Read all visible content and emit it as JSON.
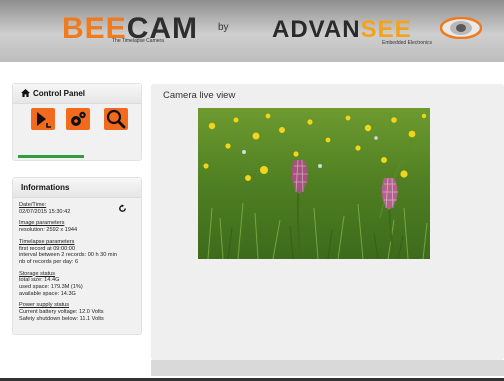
{
  "header": {
    "logo_left_part1": "BEE",
    "logo_left_part2": "CAM",
    "logo_tagline": "The Timelapse Camera",
    "by": "by",
    "logo_right_part1": "ADVAN",
    "logo_right_part2": "SEE",
    "logo_right_tagline": "Embedded Electronics",
    "eye_logo_icon": "eye-logo-icon",
    "logo_orange": "#f07a1e"
  },
  "control_panel": {
    "title": "Control Panel",
    "home_icon": "home-icon",
    "buttons": [
      {
        "icon": "play-record-icon"
      },
      {
        "icon": "settings-gears-icon"
      },
      {
        "icon": "zoom-search-icon"
      }
    ],
    "accent": "#f26b1d",
    "progress_color": "#2f9e3b"
  },
  "informations": {
    "title": "Informations",
    "datetime_title": "Date/Time:",
    "datetime_value": "02/07/2015 15:30:42",
    "refresh_icon": "refresh-icon",
    "image_title": "Image parameters",
    "image_resolution": "resolution: 2592 x 1944",
    "timelapse_title": "Timelapse parameters",
    "timelapse_first": "first record at 09:00:00",
    "timelapse_interval": "interval between 2 records: 00 h 30 min",
    "timelapse_records": "nb of records per day: 6",
    "storage_title": "Storage status",
    "storage_total": "total size: 14.4G",
    "storage_used": "used space: 179.3M (1%)",
    "storage_available": "available space: 14.3G",
    "power_title": "Power supply status",
    "power_battery": "Current battery voltage: 12.0 Volts",
    "power_shutdown": "Safety shutdown below: 11.1 Volts"
  },
  "main": {
    "title": "Camera live view"
  }
}
